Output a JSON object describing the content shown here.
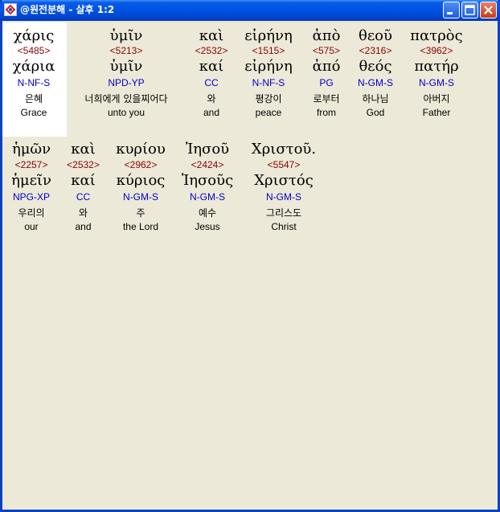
{
  "window": {
    "title": "@원전분해 - 살후 1:2",
    "colors": {
      "titlebar": "#0054e3",
      "background": "#ece9d8",
      "strong_number": "#8b0000",
      "parsing": "#0000cc",
      "highlight": "#ffffff"
    }
  },
  "words": [
    {
      "greek": "χάρις",
      "strong": "<5485>",
      "lemma": "χάρια",
      "parse": "N-NF-S",
      "korean": "은혜",
      "english": "Grace"
    },
    {
      "greek": "ὑμῖν",
      "strong": "<5213>",
      "lemma": "ὑμῖν",
      "parse": "NPD-YP",
      "korean": "너희에게 있을찌어다",
      "english": "unto you"
    },
    {
      "greek": "καὶ",
      "strong": "<2532>",
      "lemma": "καί",
      "parse": "CC",
      "korean": "와",
      "english": "and"
    },
    {
      "greek": "εἰρήνη",
      "strong": "<1515>",
      "lemma": "εἰρήνη",
      "parse": "N-NF-S",
      "korean": "평강이",
      "english": "peace"
    },
    {
      "greek": "ἀπὸ",
      "strong": "<575>",
      "lemma": "ἀπό",
      "parse": "PG",
      "korean": "로부터",
      "english": "from"
    },
    {
      "greek": "θεοῦ",
      "strong": "<2316>",
      "lemma": "θεός",
      "parse": "N-GM-S",
      "korean": "하나님",
      "english": "God"
    },
    {
      "greek": "πατρὸς",
      "strong": "<3962>",
      "lemma": "πατήρ",
      "parse": "N-GM-S",
      "korean": "아버지",
      "english": "Father"
    },
    {
      "greek": "ἡμῶν",
      "strong": "<2257>",
      "lemma": "ἡμεῖν",
      "parse": "NPG-XP",
      "korean": "우리의",
      "english": "our"
    },
    {
      "greek": "καὶ",
      "strong": "<2532>",
      "lemma": "καί",
      "parse": "CC",
      "korean": "와",
      "english": "and"
    },
    {
      "greek": "κυρίου",
      "strong": "<2962>",
      "lemma": "κύριος",
      "parse": "N-GM-S",
      "korean": "주",
      "english": "the Lord"
    },
    {
      "greek": "Ἰησοῦ",
      "strong": "<2424>",
      "lemma": "Ἰησοῦς",
      "parse": "N-GM-S",
      "korean": "예수",
      "english": "Jesus"
    },
    {
      "greek": "Χριστοῦ.",
      "strong": "<5547>",
      "lemma": "Χριστός",
      "parse": "N-GM-S",
      "korean": "그리스도",
      "english": "Christ"
    }
  ]
}
